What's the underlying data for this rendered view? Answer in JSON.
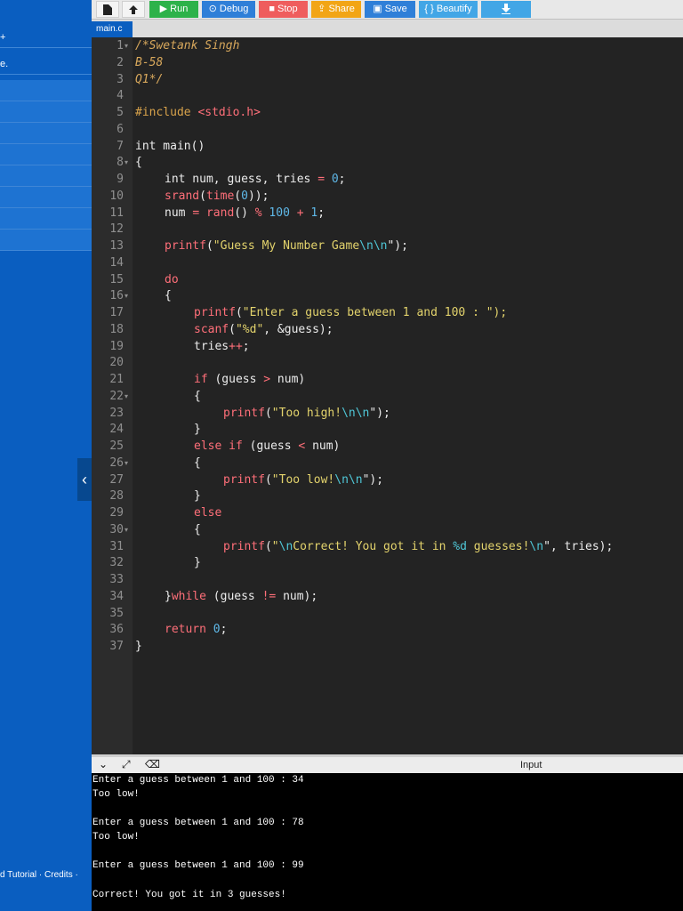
{
  "toolbar": {
    "buttons": [
      {
        "label": "",
        "icon": "new-file-icon"
      },
      {
        "label": "",
        "icon": "upload-icon"
      },
      {
        "label": "Run",
        "icon": "play-icon",
        "color": "#2db24a"
      },
      {
        "label": "Debug",
        "icon": "debug-icon",
        "color": "#2f7fd8"
      },
      {
        "label": "Stop",
        "icon": "stop-icon",
        "color": "#ef5d5d"
      },
      {
        "label": "Share",
        "icon": "share-icon",
        "color": "#f2a516"
      },
      {
        "label": "Save",
        "icon": "save-icon",
        "color": "#2f7fd8"
      },
      {
        "label": "{ } Beautify",
        "icon": "beautify-icon",
        "color": "#42a6e6"
      },
      {
        "label": "",
        "icon": "download-icon",
        "color": "#42a6e6"
      }
    ]
  },
  "tabs": [
    {
      "label": "main.c"
    }
  ],
  "sidebar": {
    "items": [
      "+",
      "e.",
      "",
      "",
      "",
      "",
      "",
      "",
      "",
      ""
    ],
    "footer": "d Tutorial · Credits ·"
  },
  "editor": {
    "lines": [
      "1",
      "2",
      "3",
      "4",
      "5",
      "6",
      "7",
      "8",
      "9",
      "10",
      "11",
      "12",
      "13",
      "14",
      "15",
      "16",
      "17",
      "18",
      "19",
      "20",
      "21",
      "22",
      "23",
      "24",
      "25",
      "26",
      "27",
      "28",
      "29",
      "30",
      "31",
      "32",
      "33",
      "34",
      "35",
      "36",
      "37"
    ],
    "code": {
      "c1": "/*Swetank Singh",
      "c2": "B-58",
      "c3": "Q1*/",
      "inc": "#include",
      "inc_file": "<stdio.h>",
      "main": "int main()",
      "open_brace": "{",
      "l9_a": "int num, guess, tries ",
      "eq": "=",
      "zero": "0",
      "semi": ";",
      "srand": "srand",
      "time": "time",
      "l10_paren1": "(",
      "l10_paren2": "(",
      "l10_close": "));",
      "num_assign": "num ",
      "rand": "rand",
      "rand_parens": "() ",
      "mod": "%",
      "hundred": " 100 ",
      "plus": "+",
      "one": " 1",
      "printf": "printf",
      "scanf": "scanf",
      "l13_str": "\"Guess My Number Game",
      "esc_nn": "\\n\\n",
      "quote_close": "\");",
      "do": "do",
      "l17_str": "\"Enter a guess between 1 and 100 : \");",
      "l18_fmt": "\"%d\"",
      "l18_rest": ", &guess);",
      "tries": "tries",
      "plusplus": "++",
      "if": "if",
      "guess_open": " (guess ",
      "gt": ">",
      "lt": "<",
      "num_close": " num)",
      "too_high": "\"Too high!",
      "too_low": "\"Too low!",
      "else_if": "else if",
      "else": "else",
      "esc_n": "\\n",
      "correct": "Correct! You got it in ",
      "pct_d": "%d",
      "guesses": " guesses!",
      "l31_end": "\", tries);",
      "close_brace": "}",
      "while": "while",
      "while_guess": " (guess ",
      "neq": "!=",
      "while_end": " num);",
      "return": "return",
      "ret_val": " 0",
      "l2": "(",
      "paren_open": "(",
      "quote_open": "\""
    }
  },
  "console": {
    "title": "Input",
    "output": [
      "Enter a guess between 1 and 100 : 34",
      "Too low!",
      "",
      "Enter a guess between 1 and 100 : 78",
      "Too low!",
      "",
      "Enter a guess between 1 and 100 : 99",
      "",
      "Correct! You got it in 3 guesses!"
    ]
  }
}
